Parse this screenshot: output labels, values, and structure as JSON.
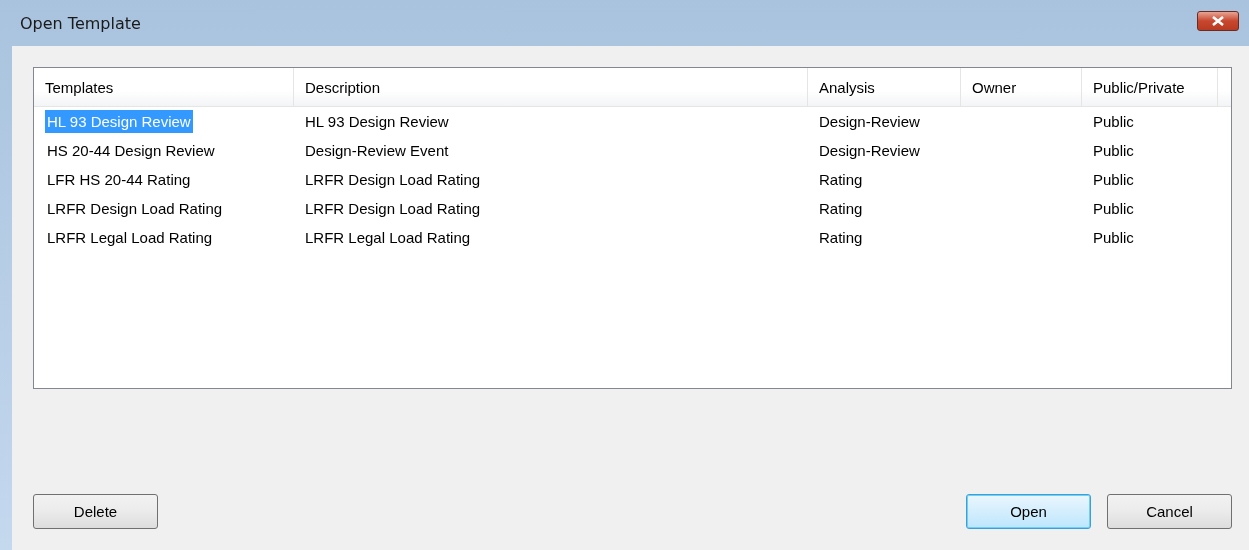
{
  "window": {
    "title": "Open Template"
  },
  "table": {
    "columns": [
      "Templates",
      "Description",
      "Analysis",
      "Owner",
      "Public/Private"
    ],
    "rows": [
      {
        "template": "HL 93 Design Review",
        "description": "HL 93 Design Review",
        "analysis": "Design-Review",
        "access": "Public",
        "selected": true
      },
      {
        "template": "HS 20-44 Design Review",
        "description": "Design-Review Event",
        "analysis": "Design-Review",
        "access": "Public",
        "selected": false
      },
      {
        "template": "LFR HS 20-44 Rating",
        "description": "LRFR Design Load Rating",
        "analysis": "Rating",
        "access": "Public",
        "selected": false
      },
      {
        "template": "LRFR Design Load Rating",
        "description": "LRFR Design Load Rating",
        "analysis": "Rating",
        "access": "Public",
        "selected": false
      },
      {
        "template": "LRFR Legal Load Rating",
        "description": "LRFR Legal Load Rating",
        "analysis": "Rating",
        "access": "Public",
        "selected": false
      }
    ]
  },
  "left_buttons": [
    {
      "label": "Delete",
      "default": false
    }
  ],
  "right_buttons": [
    {
      "label": "Open",
      "default": true
    },
    {
      "label": "Cancel",
      "default": false
    }
  ]
}
